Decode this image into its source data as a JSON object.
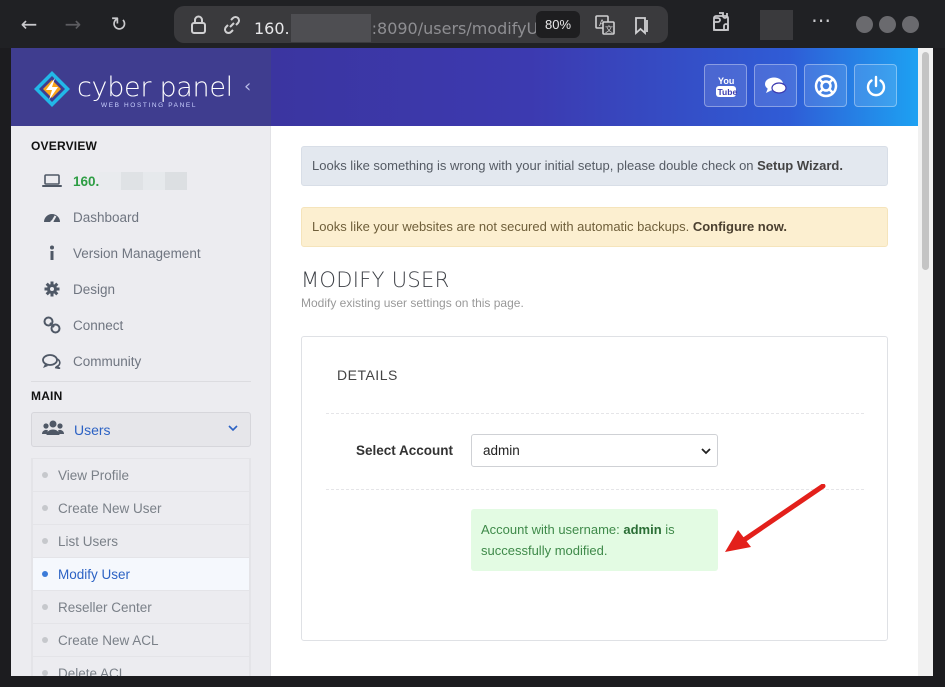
{
  "browser": {
    "url_prefix": "160.",
    "url_suffix": ":8090/users/modifyU",
    "zoom": "80%"
  },
  "brand": {
    "name": "cyber panel",
    "tagline": "WEB HOSTING PANEL"
  },
  "sidebar": {
    "overview_title": "OVERVIEW",
    "ip_prefix": "160.",
    "items": [
      {
        "label": "Dashboard",
        "icon": "dashboard-icon"
      },
      {
        "label": "Version Management",
        "icon": "info-icon"
      },
      {
        "label": "Design",
        "icon": "gear-icon"
      },
      {
        "label": "Connect",
        "icon": "link-icon"
      },
      {
        "label": "Community",
        "icon": "chat-icon"
      }
    ],
    "main_title": "MAIN",
    "users_label": "Users",
    "sub_items": [
      {
        "label": "View Profile"
      },
      {
        "label": "Create New User"
      },
      {
        "label": "List Users"
      },
      {
        "label": "Modify User"
      },
      {
        "label": "Reseller Center"
      },
      {
        "label": "Create New ACL"
      },
      {
        "label": "Delete ACL"
      }
    ]
  },
  "alerts": {
    "setup_text": "Looks like something is wrong with your initial setup, please double check on ",
    "setup_link": "Setup Wizard.",
    "backup_text": "Looks like your websites are not secured with automatic backups. ",
    "backup_link": "Configure now."
  },
  "page": {
    "title": "MODIFY USER",
    "subtitle": "Modify existing user settings on this page."
  },
  "panel": {
    "title": "DETAILS",
    "select_label": "Select Account",
    "select_value": "admin",
    "success_prefix": "Account with username: ",
    "success_user": "admin",
    "success_suffix": " is successfully modified."
  },
  "colors": {
    "accent": "#2c62c4",
    "success_bg": "#e3fbe3",
    "warning_bg": "#fcefd0",
    "arrow": "#e3201b"
  }
}
